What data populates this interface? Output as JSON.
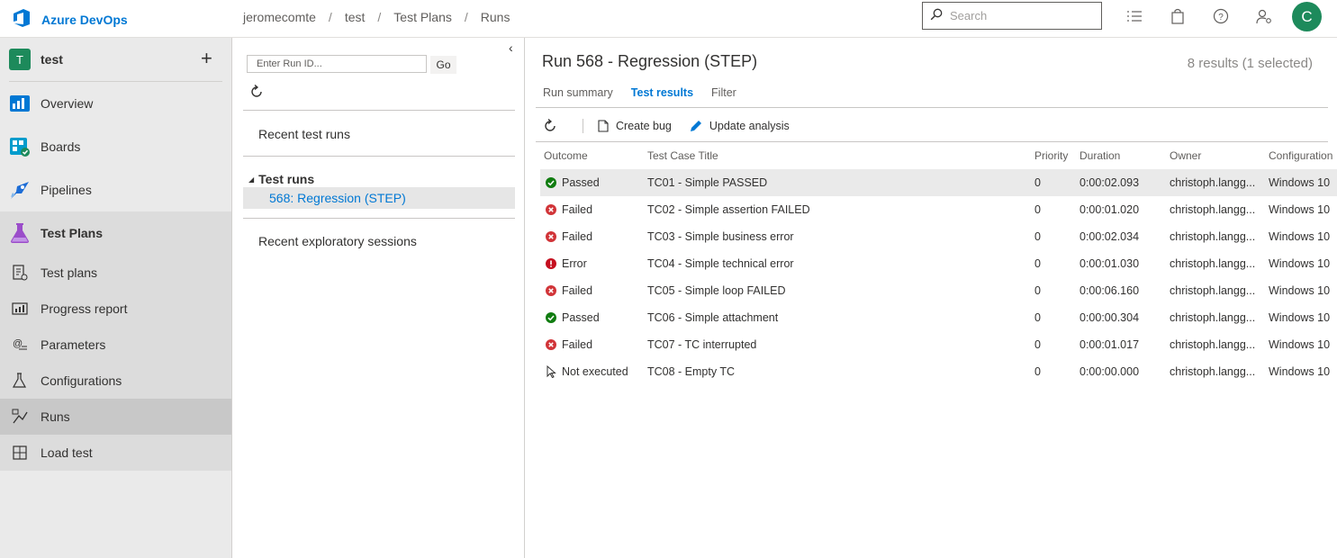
{
  "brand": {
    "name": "Azure DevOps"
  },
  "breadcrumb": [
    "jeromecomte",
    "test",
    "Test Plans",
    "Runs"
  ],
  "search": {
    "placeholder": "Search"
  },
  "user": {
    "initial": "C"
  },
  "project": {
    "badge": "T",
    "name": "test",
    "add_icon": "plus-icon"
  },
  "nav": [
    {
      "label": "Overview",
      "icon": "overview-icon"
    },
    {
      "label": "Boards",
      "icon": "boards-icon"
    },
    {
      "label": "Pipelines",
      "icon": "pipelines-icon"
    },
    {
      "label": "Test Plans",
      "icon": "test-plans-icon"
    }
  ],
  "subnav": [
    {
      "label": "Test plans",
      "icon": "test-plans-list-icon"
    },
    {
      "label": "Progress report",
      "icon": "progress-report-icon"
    },
    {
      "label": "Parameters",
      "icon": "parameters-icon"
    },
    {
      "label": "Configurations",
      "icon": "configurations-icon"
    },
    {
      "label": "Runs",
      "icon": "runs-icon",
      "active": true
    },
    {
      "label": "Load test",
      "icon": "load-test-icon"
    }
  ],
  "mid": {
    "runid_placeholder": "Enter Run ID...",
    "go_label": "Go",
    "recent_runs": "Recent test runs",
    "test_runs_header": "Test runs",
    "selected_run": "568: Regression (STEP)",
    "recent_sessions": "Recent exploratory sessions"
  },
  "main": {
    "title": "Run 568 - Regression (STEP)",
    "results_count": "8 results (1 selected)",
    "tabs": [
      "Run summary",
      "Test results",
      "Filter"
    ],
    "active_tab": "Test results",
    "toolbar": {
      "create_bug": "Create bug",
      "update_analysis": "Update analysis"
    },
    "columns": [
      "Outcome",
      "Test Case Title",
      "Priority",
      "Duration",
      "Owner",
      "Configuration"
    ],
    "rows": [
      {
        "outcome": "Passed",
        "status": "passed",
        "title": "TC01 - Simple PASSED",
        "priority": "0",
        "duration": "0:00:02.093",
        "owner": "christoph.langg...",
        "config": "Windows 10"
      },
      {
        "outcome": "Failed",
        "status": "failed",
        "title": "TC02 - Simple assertion FAILED",
        "priority": "0",
        "duration": "0:00:01.020",
        "owner": "christoph.langg...",
        "config": "Windows 10"
      },
      {
        "outcome": "Failed",
        "status": "failed",
        "title": "TC03 - Simple business error",
        "priority": "0",
        "duration": "0:00:02.034",
        "owner": "christoph.langg...",
        "config": "Windows 10"
      },
      {
        "outcome": "Error",
        "status": "error",
        "title": "TC04 - Simple technical error",
        "priority": "0",
        "duration": "0:00:01.030",
        "owner": "christoph.langg...",
        "config": "Windows 10"
      },
      {
        "outcome": "Failed",
        "status": "failed",
        "title": "TC05 - Simple loop FAILED",
        "priority": "0",
        "duration": "0:00:06.160",
        "owner": "christoph.langg...",
        "config": "Windows 10"
      },
      {
        "outcome": "Passed",
        "status": "passed",
        "title": "TC06 - Simple attachment",
        "priority": "0",
        "duration": "0:00:00.304",
        "owner": "christoph.langg...",
        "config": "Windows 10"
      },
      {
        "outcome": "Failed",
        "status": "failed",
        "title": "TC07 - TC interrupted",
        "priority": "0",
        "duration": "0:00:01.017",
        "owner": "christoph.langg...",
        "config": "Windows 10"
      },
      {
        "outcome": "Not executed",
        "status": "notexecuted",
        "title": "TC08 - Empty TC",
        "priority": "0",
        "duration": "0:00:00.000",
        "owner": "christoph.langg...",
        "config": "Windows 10"
      }
    ]
  },
  "colors": {
    "accent": "#0078d4",
    "passed": "#107c10",
    "failed": "#d13438",
    "error": "#c50f1f",
    "project": "#1d8a5b"
  }
}
